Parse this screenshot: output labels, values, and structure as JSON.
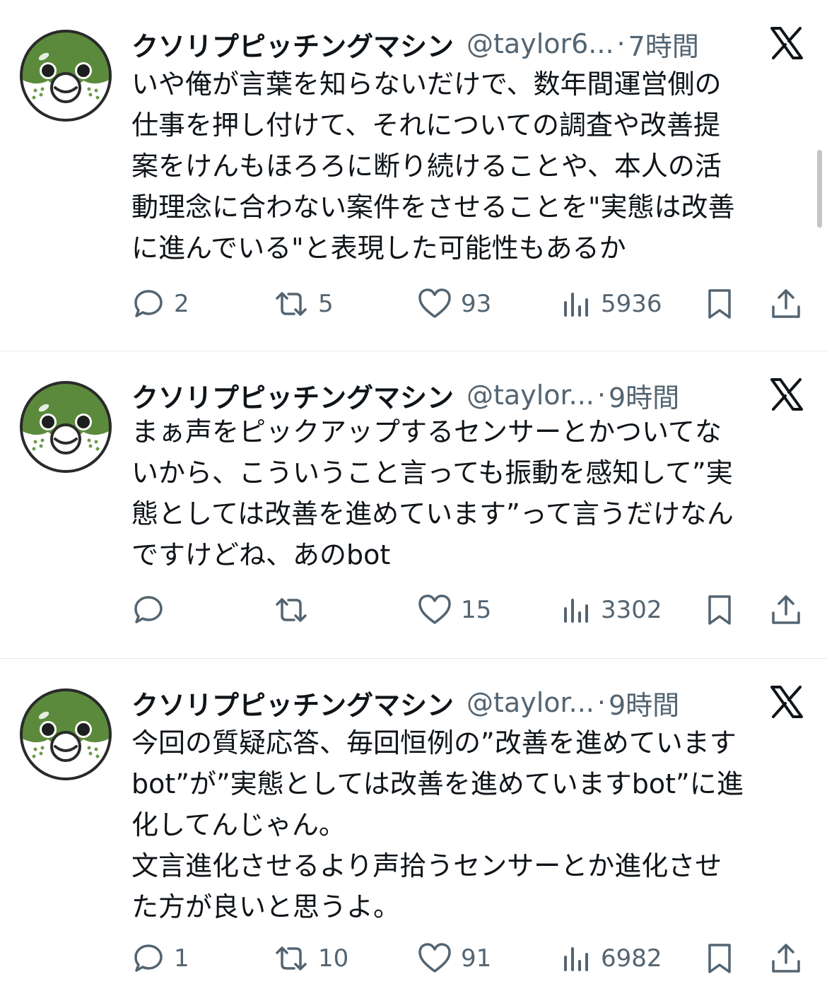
{
  "tweets": [
    {
      "name": "クソリプピッチングマシン",
      "handle": "@taylor6...",
      "separator": "·",
      "time": "7時間",
      "text": "いや俺が言葉を知らないだけで、数年間運営側の\n仕事を押し付けて、それについての調査や改善提\n案をけんもほろろに断り続けることや、本人の活\n動理念に合わない案件をさせることを\"実態は改善\nに進んでいる\"と表現した可能性もあるか",
      "replies": "2",
      "retweets": "5",
      "likes": "93",
      "views": "5936"
    },
    {
      "name": "クソリプピッチングマシン",
      "handle": "@taylor...",
      "separator": "·",
      "time": "9時間",
      "text": "まぁ声をピックアップするセンサーとかついてな\nいから、こういうこと言っても振動を感知して”実\n態としては改善を進めています”って言うだけなん\nですけどね、あのbot",
      "replies": "",
      "retweets": "",
      "likes": "15",
      "views": "3302"
    },
    {
      "name": "クソリプピッチングマシン",
      "handle": "@taylor...",
      "separator": "·",
      "time": "9時間",
      "text": "今回の質疑応答、毎回恒例の”改善を進めています\nbot”が”実態としては改善を進めていますbot”に進\n化してんじゃん。\n文言進化させるより声拾うセンサーとか進化させ\nた方が良いと思うよ。",
      "replies": "1",
      "retweets": "10",
      "likes": "91",
      "views": "6982"
    }
  ],
  "icons": {
    "avatar": "pufferfish-avatar",
    "platform": "x-logo",
    "reply": "reply-icon",
    "retweet": "retweet-icon",
    "like": "heart-icon",
    "views": "views-icon",
    "bookmark": "bookmark-icon",
    "share": "share-icon"
  },
  "colors": {
    "text": "#0f1419",
    "secondary": "#536471",
    "divider": "#e6e8ea",
    "avatar_green": "#5b8a3c"
  }
}
